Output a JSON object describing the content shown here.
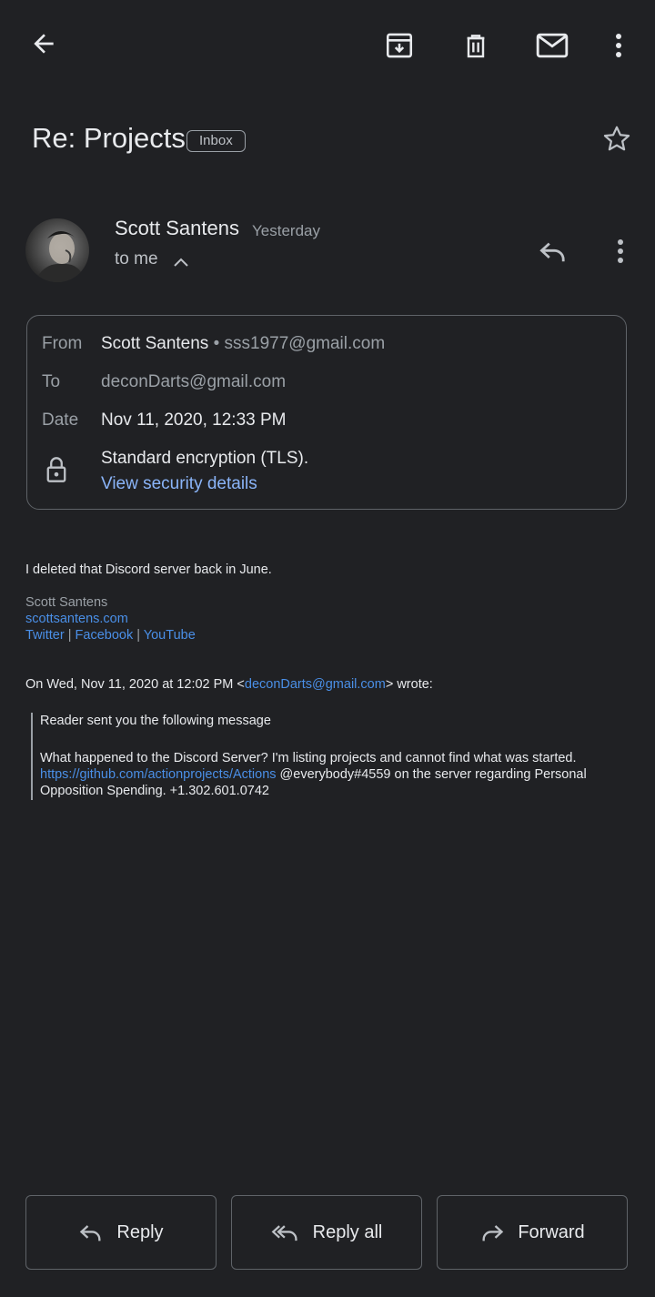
{
  "toolbar": {
    "back_icon": "arrow-left-icon",
    "archive_icon": "archive-icon",
    "delete_icon": "trash-icon",
    "mark_unread_icon": "mail-icon",
    "more_icon": "more-vert-icon"
  },
  "subject": {
    "title": "Re: Projects",
    "label_badge": "Inbox",
    "star_icon": "star-outline-icon"
  },
  "message": {
    "sender_name": "Scott Santens",
    "time": "Yesterday",
    "recipient_summary": "to me"
  },
  "details": {
    "from_label": "From",
    "from_name": "Scott Santens",
    "from_sep": " • ",
    "from_email": "sss1977@gmail.com",
    "to_label": "To",
    "to_value": "deconDarts@gmail.com",
    "date_label": "Date",
    "date_value": "Nov 11, 2020, 12:33 PM",
    "encryption_text": "Standard encryption (TLS).",
    "security_link": "View security details"
  },
  "body": {
    "line1": "I deleted that Discord server back in June.",
    "signature": {
      "name": "Scott Santens",
      "website": "scottsantens.com",
      "link_twitter": "Twitter",
      "link_facebook": "Facebook",
      "link_youtube": "YouTube",
      "separator": " | "
    },
    "quote_header_prefix": "On Wed, Nov 11, 2020 at 12:02 PM <",
    "quote_header_email": "deconDarts@gmail.com",
    "quote_header_suffix": "> wrote:",
    "quote": {
      "line1": "Reader sent you the following message",
      "line2": "What happened to the Discord Server? I'm listing projects and cannot find what was started.",
      "link": "https://github.com/actionprojects/Actions",
      "line3_rest": " @everybody#4559 on the server regarding Personal",
      "line4": "Opposition Spending. +1.302.601.0742"
    }
  },
  "actions": {
    "reply": "Reply",
    "reply_all": "Reply all",
    "forward": "Forward"
  }
}
